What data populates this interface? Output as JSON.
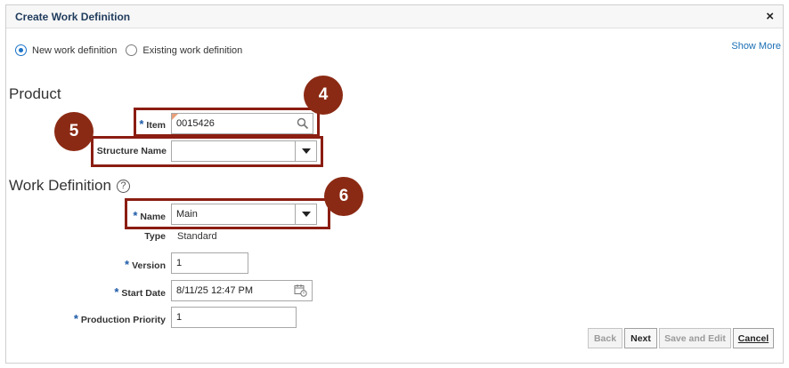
{
  "dialog": {
    "title": "Create Work Definition",
    "close_glyph": "×",
    "show_more": "Show More"
  },
  "mode": {
    "options": [
      "New work definition",
      "Existing work definition"
    ],
    "selected": "New work definition"
  },
  "product": {
    "heading": "Product",
    "item_label": "Item",
    "item_value": "0015426",
    "structure_label": "Structure Name",
    "structure_value": ""
  },
  "work_definition": {
    "heading": "Work Definition",
    "help_glyph": "?",
    "name_label": "Name",
    "name_value": "Main",
    "type_label": "Type",
    "type_value": "Standard",
    "version_label": "Version",
    "version_value": "1",
    "start_date_label": "Start Date",
    "start_date_value": "8/11/25 12:47 PM",
    "priority_label": "Production Priority",
    "priority_value": "1"
  },
  "required_marker": "*",
  "badges": [
    "4",
    "5",
    "6"
  ],
  "buttons": {
    "back": "Back",
    "next": "Next",
    "save_edit": "Save and Edit",
    "cancel": "Cancel"
  },
  "colors": {
    "highlight": "#8b1d12",
    "badge": "#8b2a14",
    "link": "#1a6fb5",
    "title": "#1f3b5c"
  }
}
